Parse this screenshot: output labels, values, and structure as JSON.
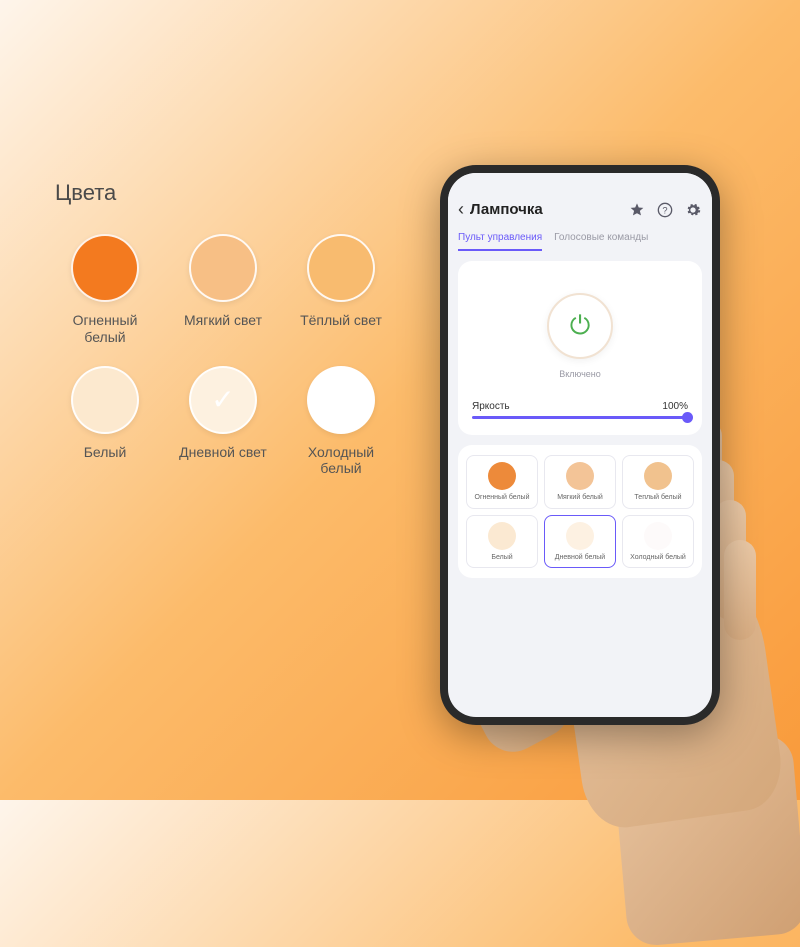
{
  "left": {
    "title": "Цвета",
    "swatches": [
      {
        "label": "Огненный\nбелый",
        "color": "#f37a1f",
        "selected": false
      },
      {
        "label": "Мягкий свет",
        "color": "#f7bf85",
        "selected": false
      },
      {
        "label": "Тёплый свет",
        "color": "#f8bb6f",
        "selected": false
      },
      {
        "label": "Белый",
        "color": "#fce9cf",
        "selected": false
      },
      {
        "label": "Дневной свет",
        "color": "#fdf1e0",
        "selected": true
      },
      {
        "label": "Холодный\nбелый",
        "color": "#ffffff",
        "selected": false
      }
    ]
  },
  "phone": {
    "title": "Лампочка",
    "tabs": {
      "control": "Пульт управления",
      "voice": "Голосовые команды"
    },
    "status": "Включено",
    "brightness_label": "Яркость",
    "brightness_value": "100%",
    "presets": [
      {
        "label": "Огненный белый",
        "color": "#ed8a3a",
        "selected": false
      },
      {
        "label": "Мягкий белый",
        "color": "#f3c497",
        "selected": false
      },
      {
        "label": "Теплый белый",
        "color": "#f1c28e",
        "selected": false
      },
      {
        "label": "Белый",
        "color": "#fbe9d2",
        "selected": false
      },
      {
        "label": "Дневной белый",
        "color": "#fdf1e2",
        "selected": true
      },
      {
        "label": "Холодный белый",
        "color": "#fdfafa",
        "selected": false
      }
    ]
  }
}
